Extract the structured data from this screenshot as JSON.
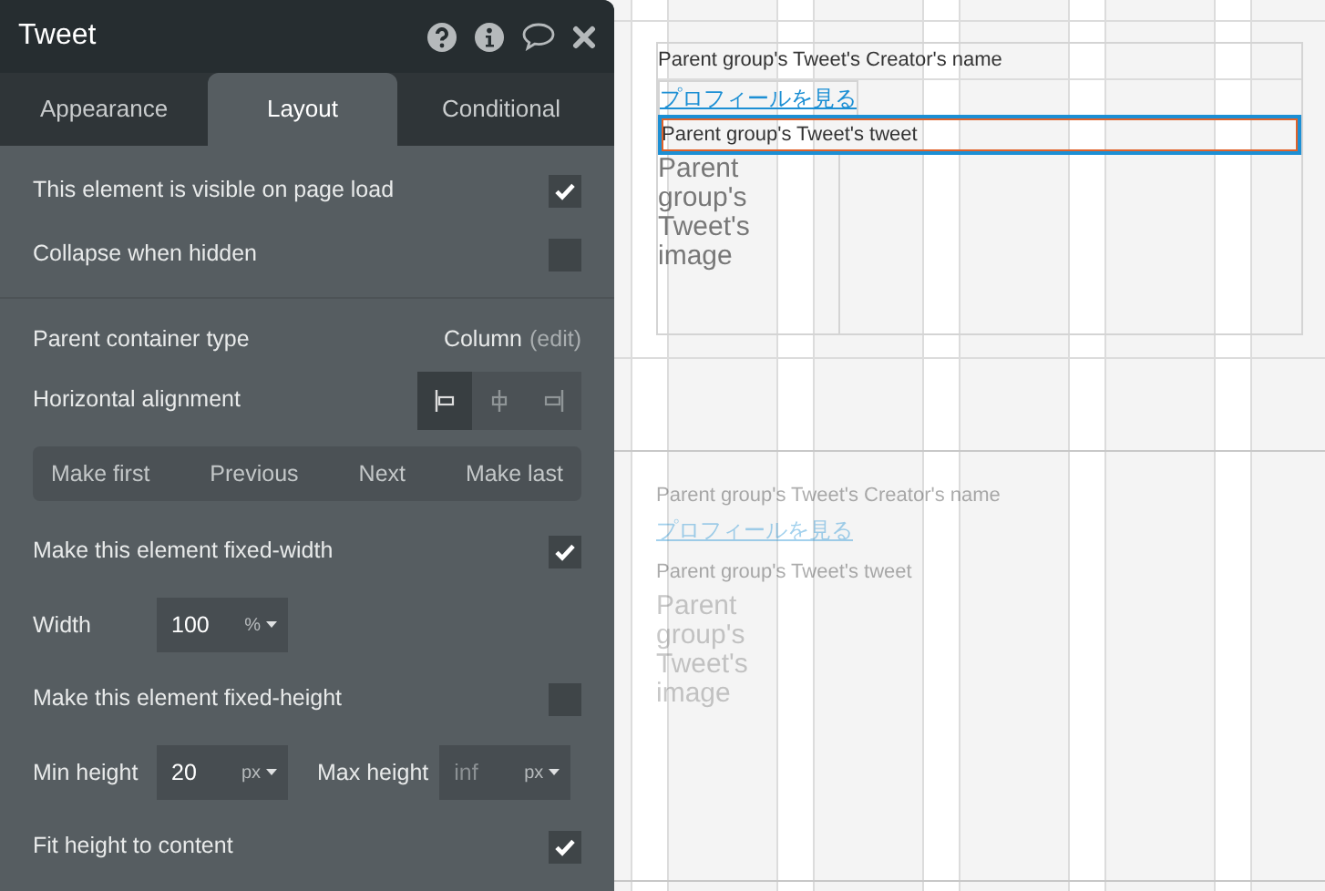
{
  "panel": {
    "title": "Tweet",
    "tabs": [
      {
        "label": "Appearance",
        "selected": false
      },
      {
        "label": "Layout",
        "selected": true
      },
      {
        "label": "Conditional",
        "selected": false
      }
    ],
    "rows": [
      {
        "kind": "checkbox",
        "label": "This element is visible on page load",
        "checked": true
      },
      {
        "kind": "checkbox",
        "label": "Collapse when hidden",
        "checked": false
      },
      {
        "kind": "divider"
      },
      {
        "kind": "value",
        "label": "Parent container type",
        "value": "Column",
        "link": "(edit)"
      },
      {
        "kind": "alignment",
        "label": "Horizontal alignment",
        "options": [
          {
            "selected": true
          },
          {
            "selected": false
          },
          {
            "selected": false
          }
        ]
      },
      {
        "kind": "buttons",
        "buttons": [
          "Make first",
          "Previous",
          "Next",
          "Make last"
        ]
      },
      {
        "kind": "checkbox",
        "label": "Make this element fixed-width",
        "checked": true
      },
      {
        "kind": "fields",
        "fields": [
          {
            "label": "Width",
            "value": "100",
            "unit": "%"
          }
        ]
      },
      {
        "kind": "checkbox",
        "label": "Make this element fixed-height",
        "checked": false
      },
      {
        "kind": "fields",
        "fields": [
          {
            "label": "Min height",
            "value": "20",
            "unit": "px"
          },
          {
            "label": "Max height",
            "placeholder": "inf",
            "unit": "px"
          }
        ]
      },
      {
        "kind": "checkbox",
        "label": "Fit height to content",
        "checked": true
      }
    ]
  },
  "canvas": {
    "cells": [
      {
        "active": true,
        "creator_name": "Parent group's Tweet's Creator's name",
        "profile_link": "プロフィールを見る",
        "tweet": "Parent group's Tweet's tweet",
        "tweet_selected": true,
        "image": "Parent group's Tweet's image"
      },
      {
        "active": false,
        "creator_name": "Parent group's Tweet's Creator's name",
        "profile_link": "プロフィールを見る",
        "tweet": "Parent group's Tweet's tweet",
        "tweet_selected": false,
        "image": "Parent group's Tweet's image"
      }
    ]
  }
}
